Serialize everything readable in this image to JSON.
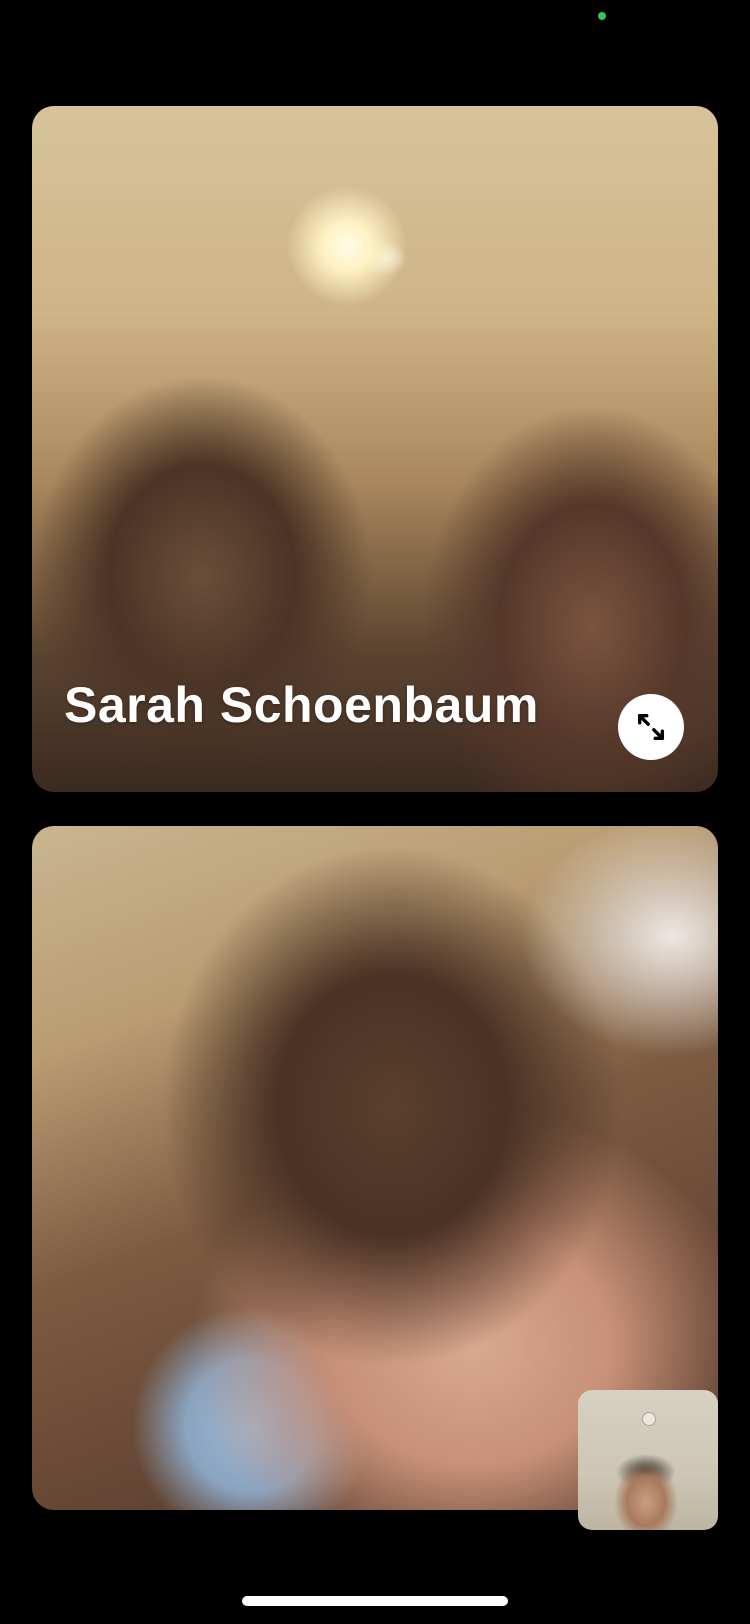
{
  "status_bar": {
    "indicator_color": "#34c759"
  },
  "call": {
    "remote_participant": {
      "name": "Sarah Schoenbaum",
      "expand_icon": "expand-arrows-icon"
    },
    "local_preview": {
      "label": ""
    }
  },
  "colors": {
    "background": "#000000",
    "label": "#ffffff",
    "button_bg": "#ffffff",
    "button_icon": "#000000"
  }
}
